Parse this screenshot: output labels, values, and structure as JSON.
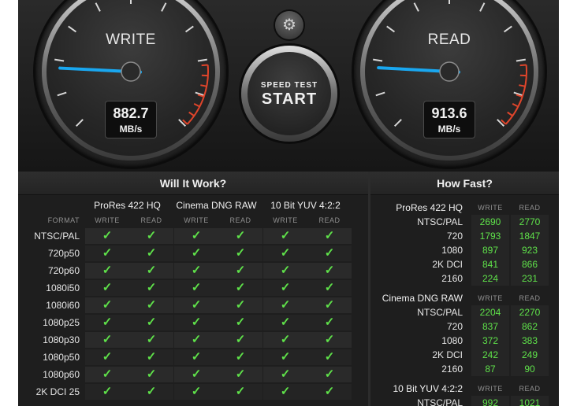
{
  "gauges": {
    "write": {
      "title": "WRITE",
      "value": "882.7",
      "unit": "MB/s"
    },
    "read": {
      "title": "READ",
      "value": "913.6",
      "unit": "MB/s"
    }
  },
  "start_button": {
    "line1": "SPEED TEST",
    "line2": "START"
  },
  "settings": {
    "icon": "gear-icon",
    "glyph": "⚙"
  },
  "will_it_work": {
    "title": "Will It Work?",
    "format_label": "FORMAT",
    "codecs": [
      "ProRes 422 HQ",
      "Cinema DNG RAW",
      "10 Bit YUV 4:2:2"
    ],
    "write_label": "WRITE",
    "read_label": "READ",
    "check_glyph": "✓",
    "formats": [
      "NTSC/PAL",
      "720p50",
      "720p60",
      "1080i50",
      "1080i60",
      "1080p25",
      "1080p30",
      "1080p50",
      "1080p60",
      "2K DCI 25"
    ]
  },
  "how_fast": {
    "title": "How Fast?",
    "write_label": "WRITE",
    "read_label": "READ",
    "groups": [
      {
        "name": "ProRes 422 HQ",
        "rows": [
          {
            "format": "NTSC/PAL",
            "write": "2690",
            "read": "2770"
          },
          {
            "format": "720",
            "write": "1793",
            "read": "1847"
          },
          {
            "format": "1080",
            "write": "897",
            "read": "923"
          },
          {
            "format": "2K DCI",
            "write": "841",
            "read": "866"
          },
          {
            "format": "2160",
            "write": "224",
            "read": "231"
          }
        ]
      },
      {
        "name": "Cinema DNG RAW",
        "rows": [
          {
            "format": "NTSC/PAL",
            "write": "2204",
            "read": "2270"
          },
          {
            "format": "720",
            "write": "837",
            "read": "862"
          },
          {
            "format": "1080",
            "write": "372",
            "read": "383"
          },
          {
            "format": "2K DCI",
            "write": "242",
            "read": "249"
          },
          {
            "format": "2160",
            "write": "87",
            "read": "90"
          }
        ]
      },
      {
        "name": "10 Bit YUV 4:2:2",
        "rows": [
          {
            "format": "NTSC/PAL",
            "write": "992",
            "read": "1021"
          }
        ]
      }
    ]
  },
  "colors": {
    "ok_green": "#5fe24a",
    "needle_blue": "#19a7f0",
    "redline": "#e0452b"
  }
}
